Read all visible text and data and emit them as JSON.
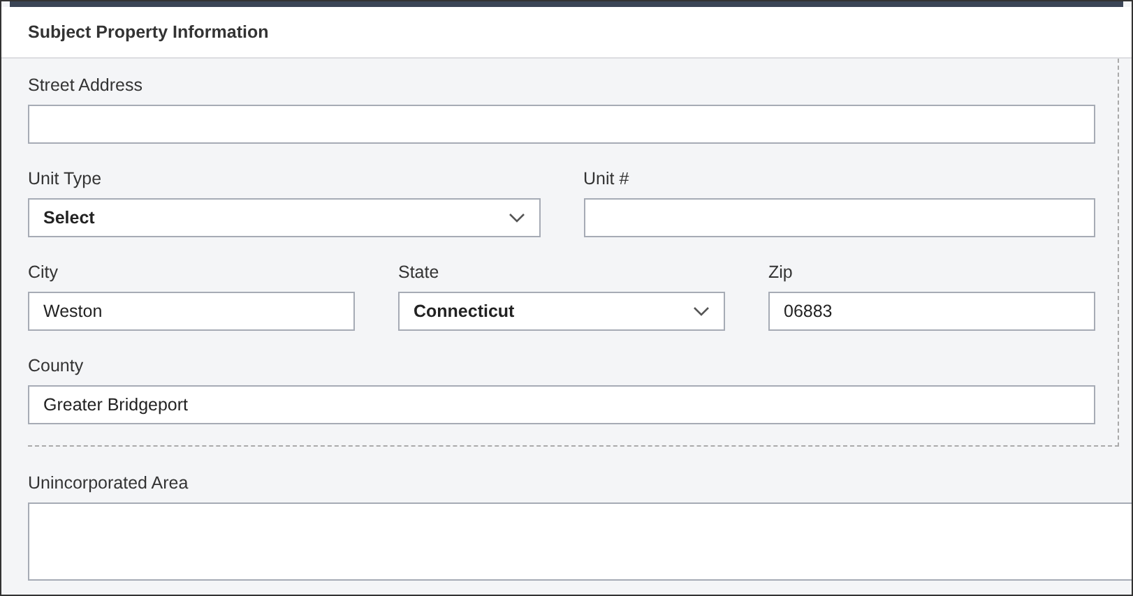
{
  "header": {
    "title": "Subject Property Information"
  },
  "rows": [
    {
      "fields": [
        {
          "kind": "text",
          "label": "Street Address"
        }
      ]
    },
    {
      "fields": [
        {
          "kind": "select",
          "label": "Unit Type",
          "value": "Select"
        },
        {
          "kind": "text",
          "label": "Unit #"
        }
      ]
    },
    {
      "fields": [
        {
          "kind": "text",
          "label": "City",
          "value": "Weston"
        },
        {
          "kind": "select",
          "label": "State",
          "value": "Connecticut"
        },
        {
          "kind": "text",
          "label": "Zip",
          "value": "06883"
        }
      ]
    },
    {
      "fields": [
        {
          "kind": "text",
          "label": "County",
          "value": "Greater Bridgeport"
        }
      ]
    }
  ],
  "extra_fields": [
    {
      "kind": "textarea",
      "label": "Unincorporated Area"
    }
  ]
}
